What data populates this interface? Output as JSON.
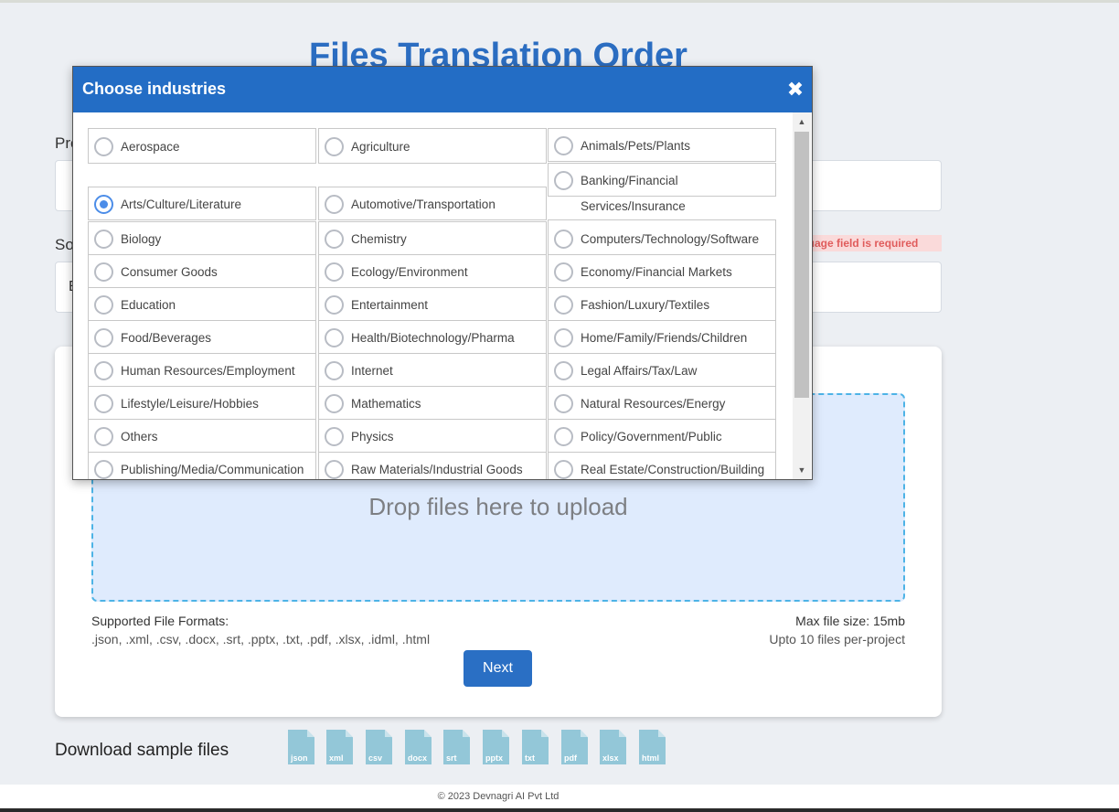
{
  "page": {
    "title": "Files Translation Order",
    "project_label": "Pro",
    "source_label": "So",
    "source_value": "E",
    "error_text": "nguage field is required"
  },
  "upload": {
    "drop_text": "Drop files here to upload",
    "formats_label": "Supported File Formats:",
    "formats_list": ".json, .xml, .csv, .docx, .srt, .pptx, .txt, .pdf, .xlsx, .idml, .html",
    "max_size": "Max file size: 15mb",
    "max_files": "Upto 10 files per-project",
    "next_label": "Next"
  },
  "samples": {
    "label": "Download sample files",
    "files": [
      "json",
      "xml",
      "csv",
      "docx",
      "srt",
      "pptx",
      "txt",
      "pdf",
      "xlsx",
      "html"
    ]
  },
  "footer": {
    "text": "© 2023 Devnagri AI Pvt Ltd"
  },
  "modal": {
    "title": "Choose industries",
    "close_icon": "close-icon",
    "selected": "Arts/Culture/Literature",
    "industries": [
      "Aerospace",
      "Agriculture",
      "Animals/Pets/Plants",
      "Banking/Financial",
      "Services/Insurance",
      "Arts/Culture/Literature",
      "Automotive/Transportation",
      "Biology",
      "Chemistry",
      "Computers/Technology/Software",
      "Consumer Goods",
      "Ecology/Environment",
      "Economy/Financial Markets",
      "Education",
      "Entertainment",
      "Fashion/Luxury/Textiles",
      "Food/Beverages",
      "Health/Biotechnology/Pharma",
      "Home/Family/Friends/Children",
      "Human Resources/Employment",
      "Internet",
      "Legal Affairs/Tax/Law",
      "Lifestyle/Leisure/Hobbies",
      "Mathematics",
      "Natural Resources/Energy",
      "Others",
      "Physics",
      "Policy/Government/Public",
      "Publishing/Media/Communication",
      "Raw Materials/Industrial Goods",
      "Real Estate/Construction/Building"
    ],
    "scroll_up": "▲",
    "scroll_down": "▼"
  }
}
